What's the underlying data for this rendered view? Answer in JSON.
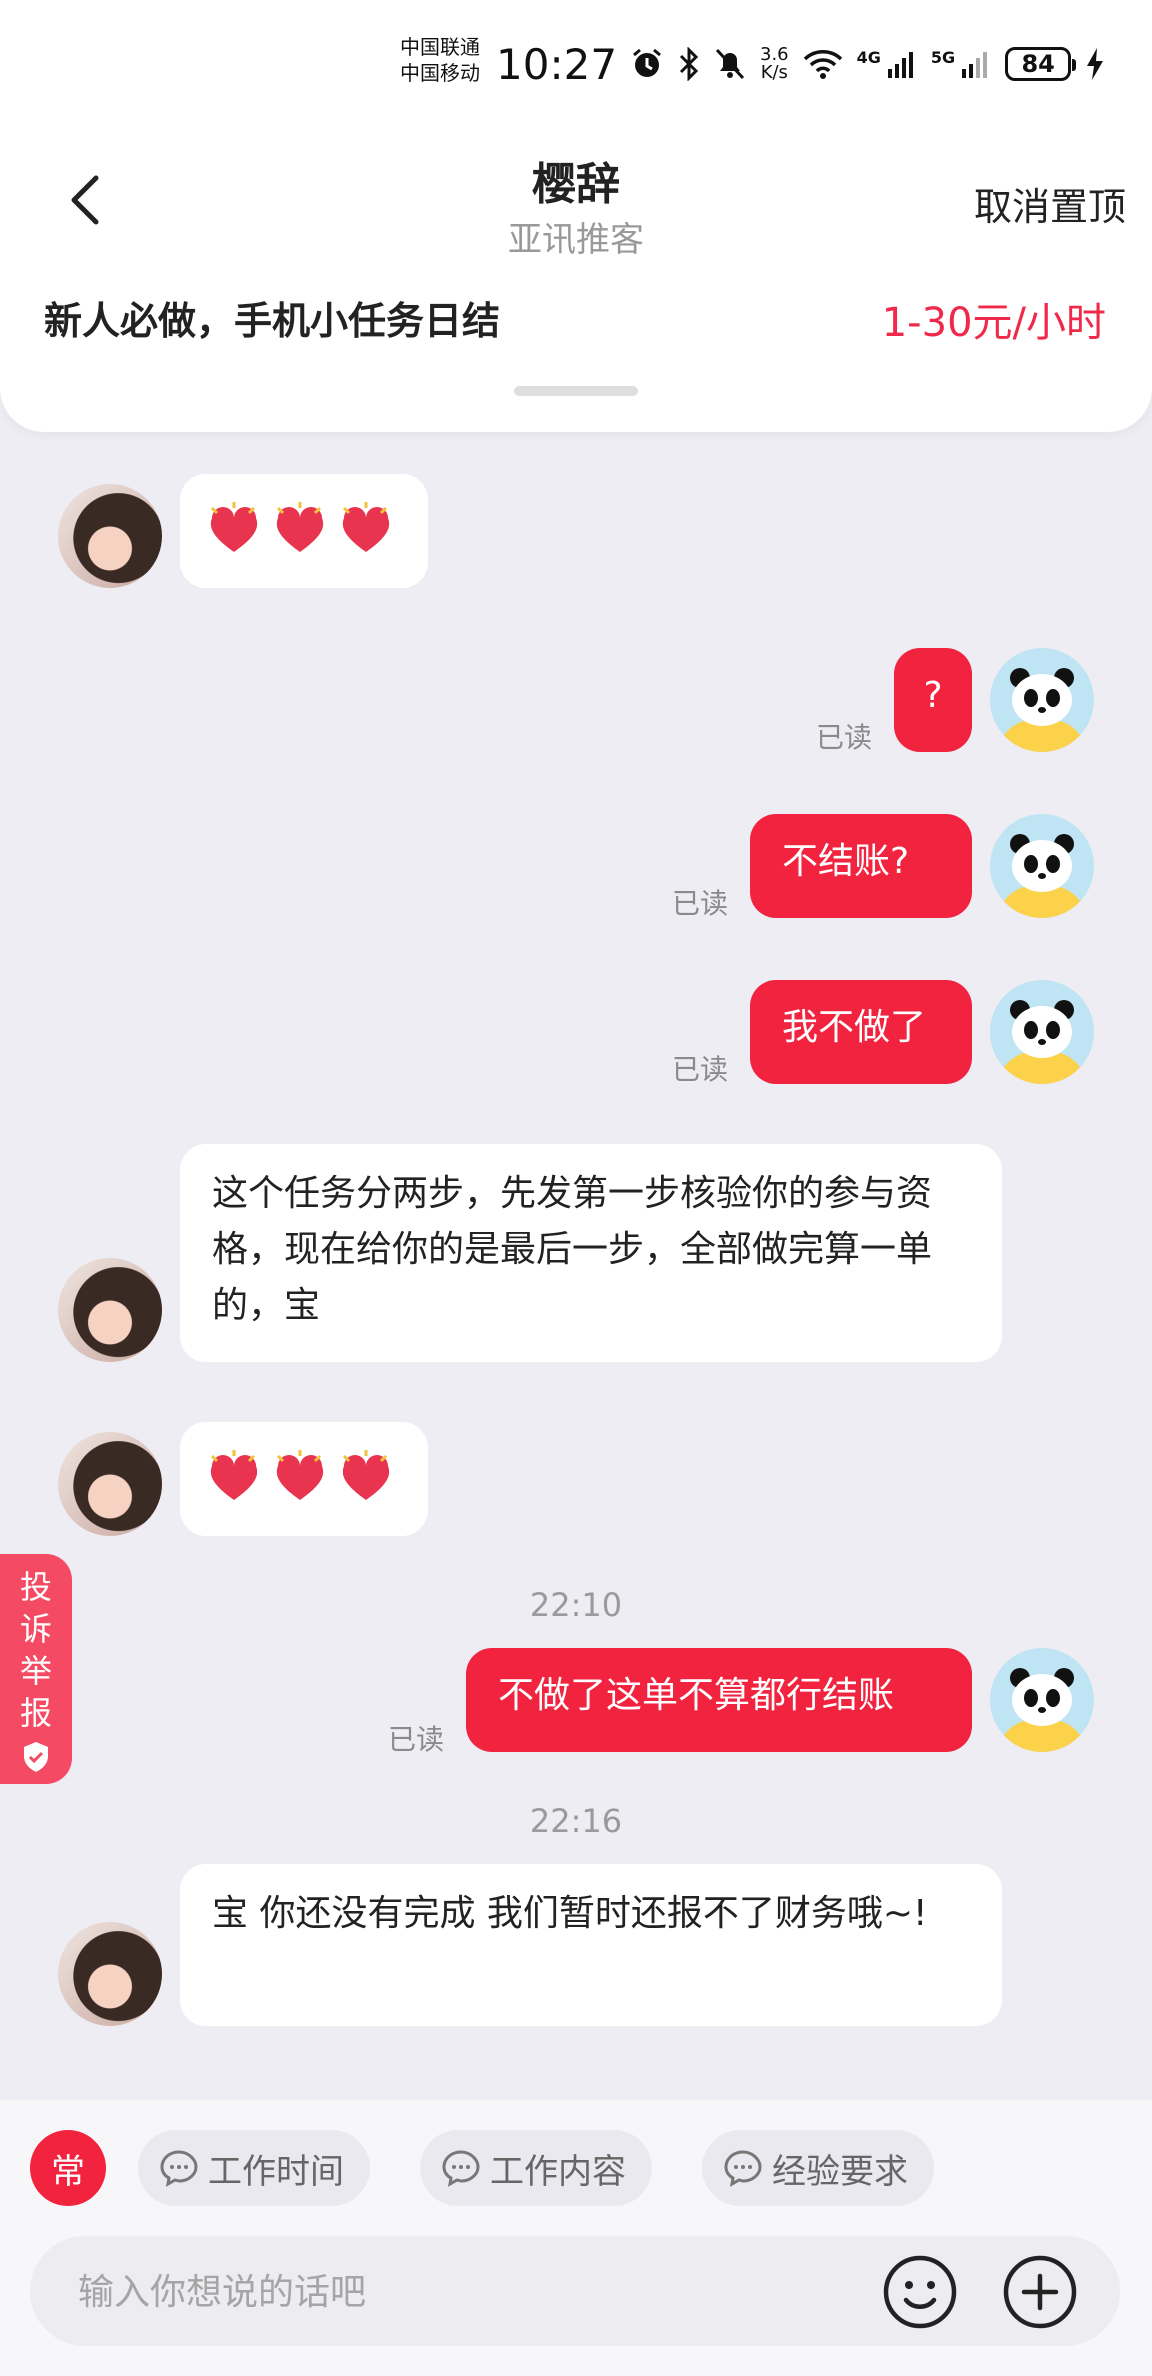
{
  "status_bar": {
    "carrier1": "中国联通",
    "carrier2": "中国移动",
    "time": "10:27",
    "net_speed_value": "3.6",
    "net_speed_unit": "K/s",
    "net_4g": "4G",
    "net_5g": "5G",
    "battery": "84"
  },
  "header": {
    "contact_name": "樱辞",
    "contact_company": "亚讯推客",
    "unpin_label": "取消置顶",
    "job_title": "新人必做，手机小任务日结",
    "job_pay": "1-30元/小时"
  },
  "messages": {
    "m2_text": "?",
    "m2_status": "已读",
    "m3_text": "不结账?",
    "m3_status": "已读",
    "m4_text": "我不做了",
    "m4_status": "已读",
    "m5_text": "这个任务分两步，先发第一步核验你的参与资格，现在给你的是最后一步，全部做完算一单的，宝",
    "time_1": "22:10",
    "m7_text": "不做了这单不算都行结账",
    "m7_status": "已读",
    "time_2": "22:16",
    "m8_text": "宝 你还没有完成 我们暂时还报不了财务哦~!"
  },
  "report": {
    "label": "投诉举报"
  },
  "quick_replies": {
    "common": "常",
    "chip1": "工作时间",
    "chip2": "工作内容",
    "chip3": "经验要求"
  },
  "composer": {
    "placeholder": "输入你想说的话吧"
  },
  "colors": {
    "accent": "#f2233f",
    "background": "#eeedf3"
  }
}
